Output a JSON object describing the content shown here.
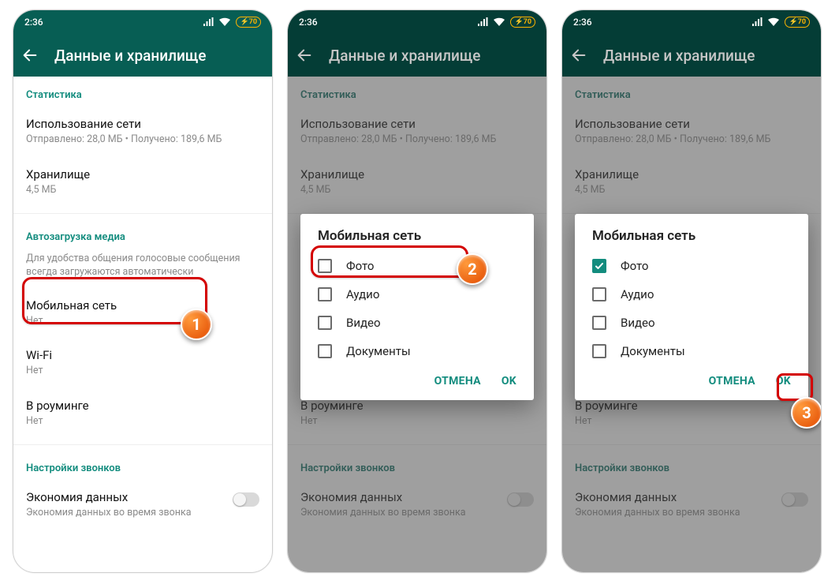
{
  "status": {
    "time": "2:36",
    "battery_pct": "70"
  },
  "appbar_title": "Данные и хранилище",
  "sections": {
    "stats": "Статистика",
    "autoload": "Автозагрузка медиа",
    "calls": "Настройки звонков"
  },
  "network_usage": {
    "title": "Использование сети",
    "sub": "Отправлено: 28,0 МБ • Получено: 189,6 МБ"
  },
  "storage": {
    "title": "Хранилище",
    "sub": "4,5 МБ"
  },
  "autoload_note": "Для удобства общения голосовые сообщения всегда загружаются автоматически",
  "mobile": {
    "title": "Мобильная сеть",
    "sub": "Нет"
  },
  "wifi": {
    "title": "Wi-Fi",
    "sub": "Нет"
  },
  "roaming": {
    "title": "В роуминге",
    "sub": "Нет"
  },
  "data_saver": {
    "title": "Экономия данных",
    "sub": "Экономия данных во время звонка"
  },
  "dialog": {
    "title": "Мобильная сеть",
    "options": {
      "photo": "Фото",
      "audio": "Аудио",
      "video": "Видео",
      "docs": "Документы"
    },
    "cancel": "ОТМЕНА",
    "ok": "OK"
  },
  "step_labels": {
    "s1": "1",
    "s2": "2",
    "s3": "3"
  }
}
